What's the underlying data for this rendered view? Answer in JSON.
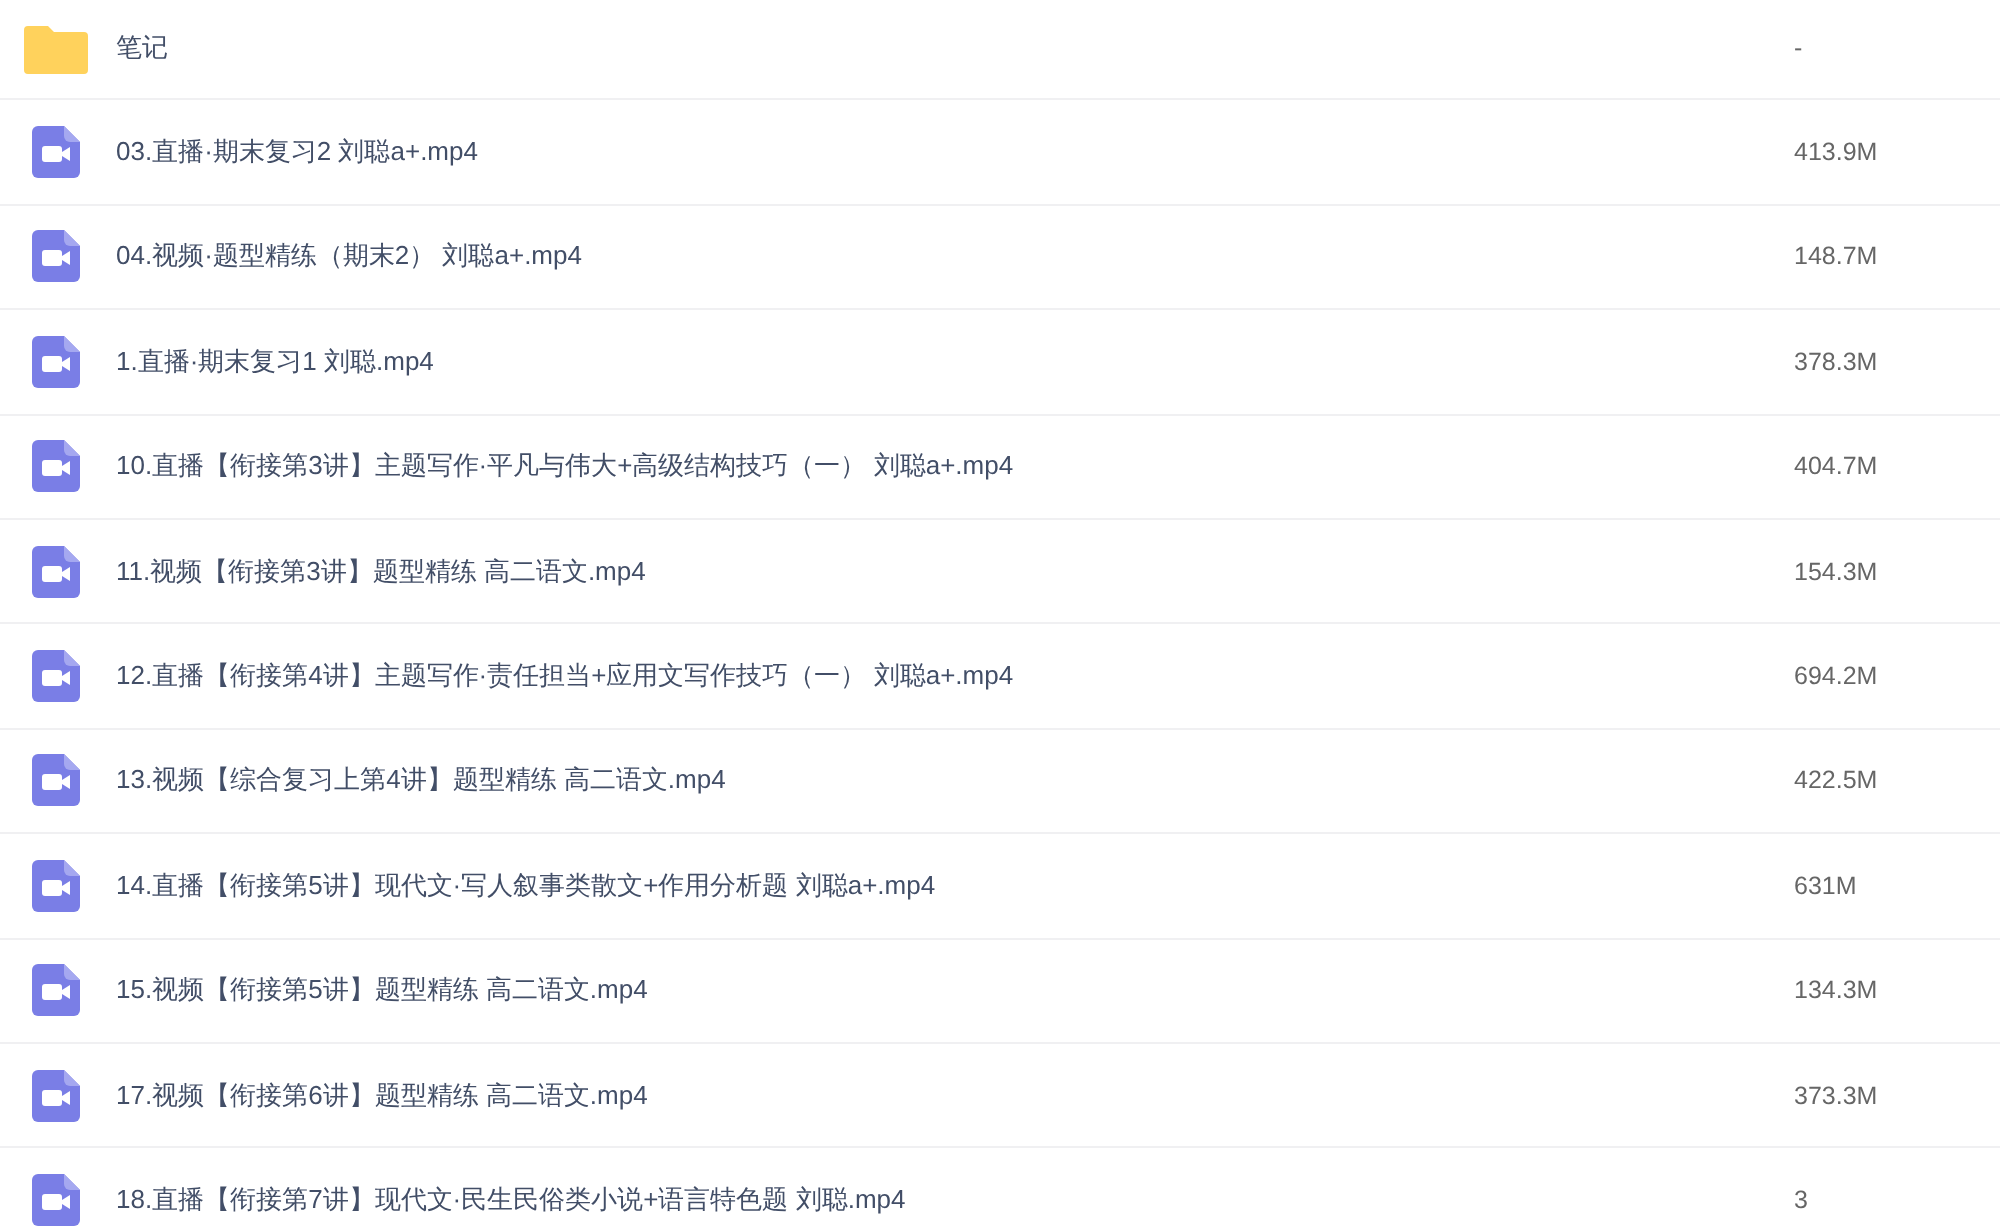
{
  "files": [
    {
      "kind": "folder",
      "name": "笔记",
      "size": "-"
    },
    {
      "kind": "video",
      "name": "03.直播·期末复习2 刘聪a+.mp4",
      "size": "413.9M"
    },
    {
      "kind": "video",
      "name": "04.视频·题型精练（期末2） 刘聪a+.mp4",
      "size": "148.7M"
    },
    {
      "kind": "video",
      "name": "1.直播·期末复习1 刘聪.mp4",
      "size": "378.3M"
    },
    {
      "kind": "video",
      "name": "10.直播【衔接第3讲】主题写作·平凡与伟大+高级结构技巧（一） 刘聪a+.mp4",
      "size": "404.7M"
    },
    {
      "kind": "video",
      "name": "11.视频【衔接第3讲】题型精练 高二语文.mp4",
      "size": "154.3M"
    },
    {
      "kind": "video",
      "name": "12.直播【衔接第4讲】主题写作·责任担当+应用文写作技巧（一） 刘聪a+.mp4",
      "size": "694.2M"
    },
    {
      "kind": "video",
      "name": "13.视频【综合复习上第4讲】题型精练 高二语文.mp4",
      "size": "422.5M"
    },
    {
      "kind": "video",
      "name": "14.直播【衔接第5讲】现代文·写人叙事类散文+作用分析题 刘聪a+.mp4",
      "size": "631M"
    },
    {
      "kind": "video",
      "name": "15.视频【衔接第5讲】题型精练 高二语文.mp4",
      "size": "134.3M"
    },
    {
      "kind": "video",
      "name": "17.视频【衔接第6讲】题型精练 高二语文.mp4",
      "size": "373.3M"
    },
    {
      "kind": "video",
      "name": "18.直播【衔接第7讲】现代文·民生民俗类小说+语言特色题 刘聪.mp4",
      "size": "3"
    }
  ]
}
